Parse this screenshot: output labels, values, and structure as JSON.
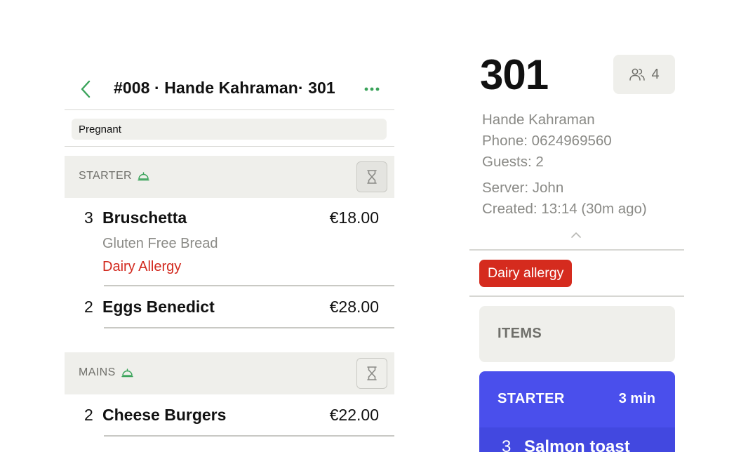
{
  "order": {
    "title": "#008 · Hande Kahraman· 301",
    "note": "Pregnant"
  },
  "courses": [
    {
      "label": "STARTER",
      "items": [
        {
          "qty": "3",
          "name": "Bruschetta",
          "price": "€18.00",
          "modifier": "Gluten Free Bread",
          "allergy": "Dairy Allergy"
        },
        {
          "qty": "2",
          "name": "Eggs Benedict",
          "price": "€28.00"
        }
      ]
    },
    {
      "label": "MAINS",
      "items": [
        {
          "qty": "2",
          "name": "Cheese Burgers",
          "price": "€22.00"
        }
      ]
    }
  ],
  "table": {
    "number": "301",
    "guest_count": "4",
    "customer": "Hande Kahraman",
    "phone": "Phone: 0624969560",
    "guests": "Guests: 2",
    "server": "Server: John",
    "created": "Created: 13:14 (30m ago)",
    "allergy_tag": "Dairy allergy"
  },
  "items_panel": {
    "header": "ITEMS",
    "course_label": "STARTER",
    "course_time": "3 min",
    "first_item_qty": "3",
    "first_item_name": "Salmon toast"
  },
  "colors": {
    "accent_green": "#3aa35a",
    "allergy_red": "#d52b1e",
    "course_blue": "#4a4fec"
  },
  "icons": {
    "back": "chevron-left-icon",
    "more": "more-horizontal-icon",
    "course_status": "cloche-icon",
    "fire": "hourglass-icon",
    "guests": "users-icon",
    "collapse": "chevron-up-icon"
  }
}
